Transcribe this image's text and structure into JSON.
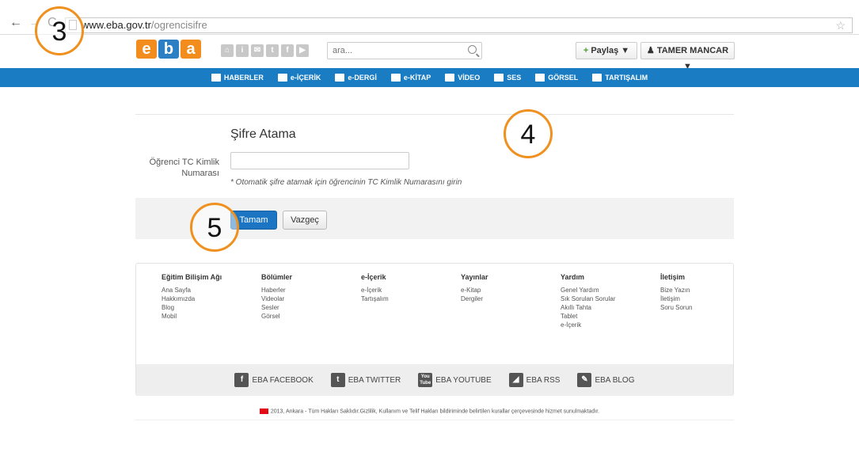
{
  "browser": {
    "url_host": "www.eba.gov.tr",
    "url_path": "/ogrencisifre",
    "back_glyph": "←",
    "forward_glyph": "→",
    "reload_glyph": "C",
    "star_glyph": "☆"
  },
  "header": {
    "logo": [
      "e",
      "b",
      "a"
    ],
    "social_icons": [
      "home-icon",
      "info-icon",
      "mail-icon",
      "twitter-icon",
      "facebook-icon",
      "youtube-icon"
    ],
    "search_placeholder": "ara...",
    "share_plus": "+",
    "share_label": "Paylaş ▼",
    "user_label": "♟ TAMER MANCAR ▼"
  },
  "nav": {
    "items": [
      {
        "label": "HABERLER",
        "icon": "news-icon"
      },
      {
        "label": "e-İÇERİK",
        "icon": "content-icon"
      },
      {
        "label": "e-DERGİ",
        "icon": "magazine-icon"
      },
      {
        "label": "e-KİTAP",
        "icon": "book-icon"
      },
      {
        "label": "VİDEO",
        "icon": "video-icon"
      },
      {
        "label": "SES",
        "icon": "sound-icon"
      },
      {
        "label": "GÖRSEL",
        "icon": "image-icon"
      },
      {
        "label": "TARTIŞALIM",
        "icon": "discussion-icon"
      }
    ]
  },
  "form": {
    "title": "Şifre Atama",
    "label": "Öğrenci TC Kimlik Numarası",
    "input_value": "",
    "help": "* Otomatik şifre atamak için öğrencinin TC Kimlik Numarasını girin",
    "ok_label": "Tamam",
    "cancel_label": "Vazgeç"
  },
  "footer": {
    "columns": [
      {
        "title": "Eğitim Bilişim Ağı",
        "links": [
          "Ana Sayfa",
          "Hakkımızda",
          "Blog",
          "Mobil"
        ]
      },
      {
        "title": "Bölümler",
        "links": [
          "Haberler",
          "Videolar",
          "Sesler",
          "Görsel"
        ]
      },
      {
        "title": "e-İçerik",
        "links": [
          "e-İçerik",
          "Tartışalım"
        ]
      },
      {
        "title": "Yayınlar",
        "links": [
          "e-Kitap",
          "Dergiler"
        ]
      },
      {
        "title": "Yardım",
        "links": [
          "Genel Yardım",
          "Sık Sorulan Sorular",
          "Akıllı Tahta",
          "Tablet",
          "e-İçerik"
        ]
      },
      {
        "title": "İletişim",
        "links": [
          "Bize Yazın",
          "İletişim",
          "Soru Sorun"
        ]
      }
    ],
    "social": [
      {
        "label": "EBA FACEBOOK",
        "icon": "facebook-icon",
        "glyph": "f"
      },
      {
        "label": "EBA TWITTER",
        "icon": "twitter-icon",
        "glyph": "t"
      },
      {
        "label": "EBA YOUTUBE",
        "icon": "youtube-icon",
        "glyph": "You Tube"
      },
      {
        "label": "EBA RSS",
        "icon": "rss-icon",
        "glyph": "◢"
      },
      {
        "label": "EBA BLOG",
        "icon": "blog-icon",
        "glyph": "✎"
      }
    ],
    "copyright": "2013, Ankara - Tüm Hakları Saklıdır.Gizlilik, Kullanım ve Telif Hakları bildiriminde belirtilen kurallar çerçevesinde hizmet sunulmaktadır."
  },
  "callouts": [
    "3",
    "4",
    "5"
  ],
  "colors": {
    "accent": "#f0901e",
    "nav_blue": "#1a7dc4",
    "button_blue": "#1b75c2"
  }
}
